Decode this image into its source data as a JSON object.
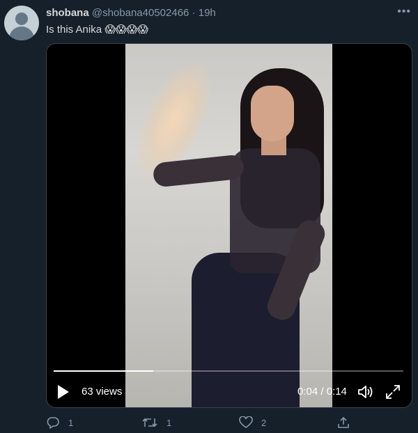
{
  "tweet": {
    "author_name": "shobana",
    "handle": "@shobana40502466",
    "separator": "·",
    "time": "19h",
    "text": "Is this Anika",
    "emojis": [
      "😱",
      "😱",
      "😱",
      "😱"
    ],
    "more_icon": "•••"
  },
  "video": {
    "views": "63 views",
    "time_display": "0:04 / 0:14",
    "progress": 0.285
  },
  "actions": {
    "reply_count": "1",
    "retweet_count": "1",
    "like_count": "2"
  },
  "colors": {
    "background": "#15202b",
    "secondary_text": "#8899a6",
    "primary_text": "#d9d9d9"
  }
}
